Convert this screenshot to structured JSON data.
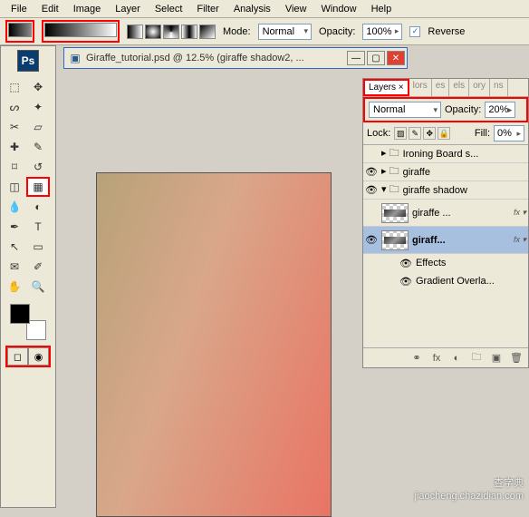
{
  "menu": {
    "items": [
      "File",
      "Edit",
      "Image",
      "Layer",
      "Select",
      "Filter",
      "Analysis",
      "View",
      "Window",
      "Help"
    ]
  },
  "optbar": {
    "mode_label": "Mode:",
    "mode_value": "Normal",
    "opacity_label": "Opacity:",
    "opacity_value": "100%",
    "reverse_label": "Reverse",
    "reverse_checked": "✓"
  },
  "app_logo": "Ps",
  "document": {
    "title": "Giraffe_tutorial.psd @ 12.5% (giraffe shadow2, ..."
  },
  "layers_panel": {
    "tab_label": "Layers ×",
    "other_tabs": [
      "lors",
      "es",
      "els",
      "ory",
      "ns"
    ],
    "blend_value": "Normal",
    "opacity_label": "Opacity:",
    "opacity_value": "20%",
    "lock_label": "Lock:",
    "fill_label": "Fill:",
    "fill_value": "0%",
    "layers": [
      {
        "name": "Ironing Board s...",
        "folder": true
      },
      {
        "name": "giraffe",
        "folder": true
      },
      {
        "name": "giraffe shadow",
        "folder": true,
        "open": true
      },
      {
        "name": "giraffe ...",
        "fx": true
      },
      {
        "name": "giraff...",
        "fx": true,
        "selected": true
      }
    ],
    "effects_label": "Effects",
    "overlay_label": "Gradient Overla..."
  },
  "watermark": {
    "line1": "查字典",
    "line2": "jiaocheng.chazidian.com"
  }
}
